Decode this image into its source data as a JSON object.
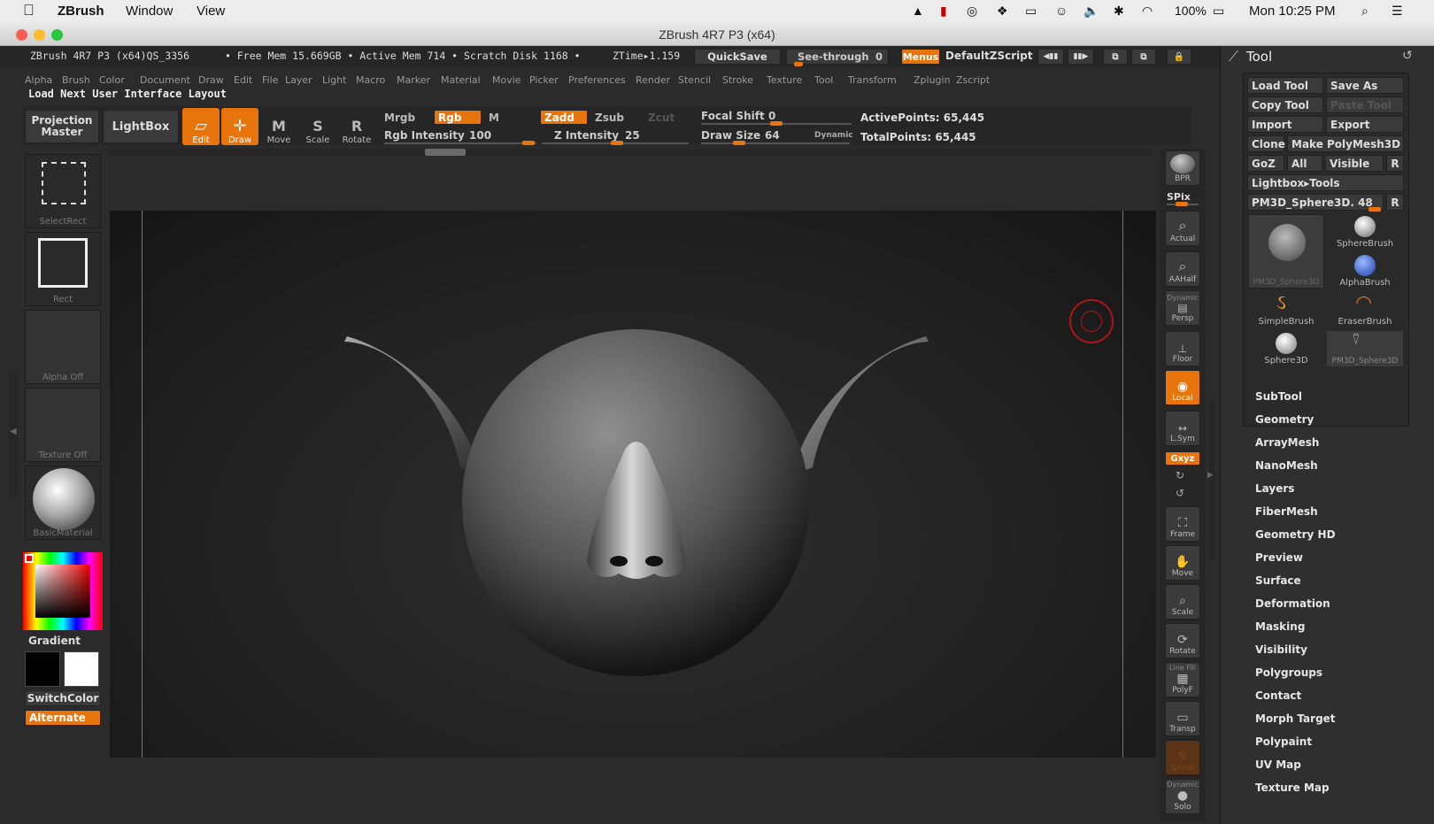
{
  "macbar": {
    "app_name": "ZBrush",
    "menus": [
      "Window",
      "View"
    ],
    "battery": "100%",
    "clock": "Mon 10:25 PM"
  },
  "window": {
    "title": "ZBrush 4R7 P3 (x64)"
  },
  "infobar": {
    "app_info": "ZBrush 4R7 P3 (x64)QS_3356",
    "stats": "• Free Mem 15.669GB • Active Mem 714 • Scratch Disk 1168 •",
    "ztime": "ZTime▸1.159",
    "quicksave": "QuickSave",
    "seethrough": "See-through",
    "seethrough_value": "0",
    "menus": "Menus",
    "zscript": "DefaultZScript"
  },
  "menubar": [
    "Alpha",
    "Brush",
    "Color",
    "Document",
    "Draw",
    "Edit",
    "File",
    "Layer",
    "Light",
    "Macro",
    "Marker",
    "Material",
    "Movie",
    "Picker",
    "Preferences",
    "Render",
    "Stencil",
    "Stroke",
    "Texture",
    "Tool",
    "Transform",
    "Zplugin",
    "Zscript"
  ],
  "notice": "Load Next User Interface Layout",
  "toolbar": {
    "projection_master": "Projection Master",
    "lightbox": "LightBox",
    "edit": "Edit",
    "draw": "Draw",
    "move": "Move",
    "scale": "Scale",
    "rotate": "Rotate",
    "mrgb": "Mrgb",
    "rgb": "Rgb",
    "m": "M",
    "zadd": "Zadd",
    "zsub": "Zsub",
    "zcut": "Zcut",
    "rgb_intensity_label": "Rgb Intensity",
    "rgb_intensity": "100",
    "z_intensity_label": "Z Intensity",
    "z_intensity": "25",
    "focal_shift_label": "Focal Shift",
    "focal_shift": "0",
    "draw_size_label": "Draw Size",
    "draw_size": "64",
    "dynamic": "Dynamic",
    "active_points": "ActivePoints: 65,445",
    "total_points": "TotalPoints: 65,445"
  },
  "left_shelf": {
    "select_rect": "SelectRect",
    "rect": "Rect",
    "alpha": "Alpha Off",
    "texture": "Texture Off",
    "material": "BasicMaterial",
    "gradient": "Gradient",
    "switch_color": "SwitchColor",
    "alternate": "Alternate"
  },
  "right_shelf": {
    "bpr": "BPR",
    "spix": "SPix",
    "actual": "Actual",
    "aahalf": "AAHalf",
    "dynamic": "Dynamic",
    "persp": "Persp",
    "floor": "Floor",
    "local": "Local",
    "lsym": "L.Sym",
    "xyz": "Gxyz",
    "frame": "Frame",
    "move": "Move",
    "scale": "Scale",
    "rotate": "Rotate",
    "linefill": "Line Fill",
    "polyf": "PolyF",
    "transp": "Transp",
    "ghost": "Ghost",
    "solo_dynamic": "Dynamic",
    "solo": "Solo"
  },
  "tool_panel": {
    "title": "Tool",
    "load_tool": "Load Tool",
    "save_as": "Save As",
    "copy_tool": "Copy Tool",
    "paste_tool": "Paste Tool",
    "import": "Import",
    "export": "Export",
    "clone": "Clone",
    "make_polymesh": "Make PolyMesh3D",
    "goz": "GoZ",
    "all": "All",
    "visible": "Visible",
    "r": "R",
    "lightbox_tools": "Lightbox▸Tools",
    "current_tool": "PM3D_Sphere3D. 48",
    "thumbs": [
      "PM3D_Sphere3D",
      "SphereBrush",
      "AlphaBrush",
      "SimpleBrush",
      "EraserBrush",
      "Sphere3D",
      "PM3D_Sphere3D"
    ],
    "sections": [
      "SubTool",
      "Geometry",
      "ArrayMesh",
      "NanoMesh",
      "Layers",
      "FiberMesh",
      "Geometry HD",
      "Preview",
      "Surface",
      "Deformation",
      "Masking",
      "Visibility",
      "Polygroups",
      "Contact",
      "Morph Target",
      "Polypaint",
      "UV Map",
      "Texture Map"
    ]
  },
  "colors": {
    "accent": "#e8740c",
    "canvas": "#000000",
    "ui": "#2b2b2b"
  }
}
